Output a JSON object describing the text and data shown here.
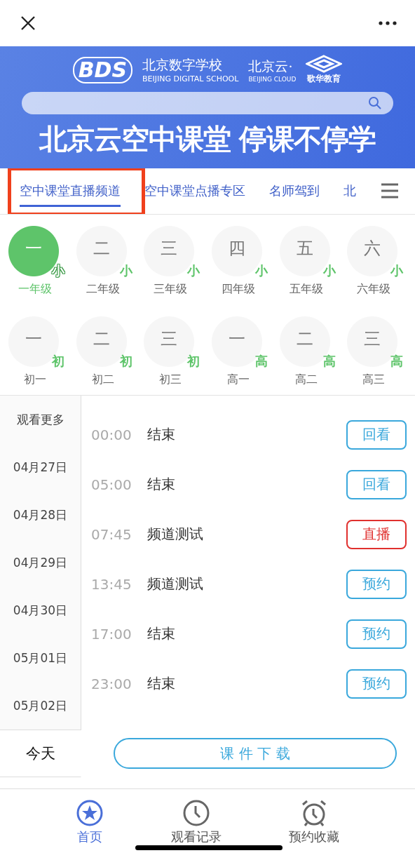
{
  "banner": {
    "logo_mark": "BDS",
    "school_name": "北京数字学校",
    "school_name_en": "BEIJING DIGITAL SCHOOL",
    "cloud_name": "北京云·",
    "cloud_name_en": "BEIJING CLOUD",
    "partner": "歌华教育",
    "headline": "北京云空中课堂 停课不停学"
  },
  "tabs": [
    {
      "label": "空中课堂直播频道",
      "selected": true
    },
    {
      "label": "空中课堂点播专区",
      "selected": false
    },
    {
      "label": "名师驾到",
      "selected": false
    },
    {
      "label": "北",
      "selected": false
    }
  ],
  "grade_rows": [
    [
      {
        "numeral": "一",
        "stage": "小",
        "label": "一年级",
        "selected": true
      },
      {
        "numeral": "二",
        "stage": "小",
        "label": "二年级",
        "selected": false
      },
      {
        "numeral": "三",
        "stage": "小",
        "label": "三年级",
        "selected": false
      },
      {
        "numeral": "四",
        "stage": "小",
        "label": "四年级",
        "selected": false
      },
      {
        "numeral": "五",
        "stage": "小",
        "label": "五年级",
        "selected": false
      },
      {
        "numeral": "六",
        "stage": "小",
        "label": "六年级",
        "selected": false
      }
    ],
    [
      {
        "numeral": "一",
        "stage": "初",
        "label": "初一",
        "selected": false
      },
      {
        "numeral": "二",
        "stage": "初",
        "label": "初二",
        "selected": false
      },
      {
        "numeral": "三",
        "stage": "初",
        "label": "初三",
        "selected": false
      },
      {
        "numeral": "一",
        "stage": "高",
        "label": "高一",
        "selected": false
      },
      {
        "numeral": "二",
        "stage": "高",
        "label": "高二",
        "selected": false
      },
      {
        "numeral": "三",
        "stage": "高",
        "label": "高三",
        "selected": false
      }
    ]
  ],
  "dates": [
    {
      "label": "观看更多",
      "selected": false
    },
    {
      "label": "04月27日",
      "selected": false
    },
    {
      "label": "04月28日",
      "selected": false
    },
    {
      "label": "04月29日",
      "selected": false
    },
    {
      "label": "04月30日",
      "selected": false
    },
    {
      "label": "05月01日",
      "selected": false
    },
    {
      "label": "05月02日",
      "selected": false
    },
    {
      "label": "今天",
      "selected": true
    }
  ],
  "schedule": [
    {
      "time": "00:00",
      "title": "结束",
      "action": "回看",
      "kind": "replay"
    },
    {
      "time": "05:00",
      "title": "结束",
      "action": "回看",
      "kind": "replay"
    },
    {
      "time": "07:45",
      "title": "频道测试",
      "action": "直播",
      "kind": "live"
    },
    {
      "time": "13:45",
      "title": "频道测试",
      "action": "预约",
      "kind": "reserve"
    },
    {
      "time": "17:00",
      "title": "结束",
      "action": "预约",
      "kind": "reserve"
    },
    {
      "time": "23:00",
      "title": "结束",
      "action": "预约",
      "kind": "reserve"
    }
  ],
  "download_button": "课 件 下 载",
  "bottom_nav": [
    {
      "label": "首页",
      "kind": "home",
      "selected": true
    },
    {
      "label": "观看记录",
      "kind": "history",
      "selected": false
    },
    {
      "label": "预约收藏",
      "kind": "reminders",
      "selected": false
    }
  ]
}
